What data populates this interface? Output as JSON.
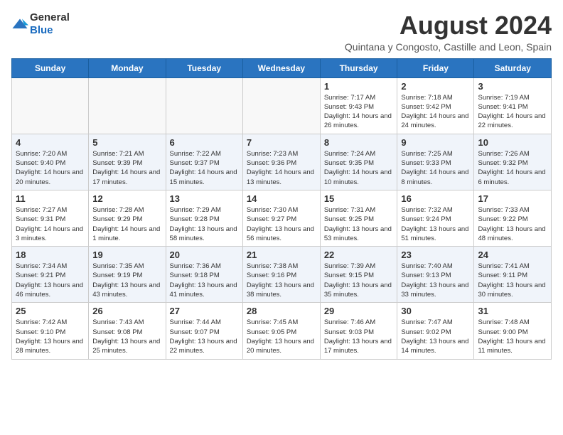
{
  "header": {
    "logo_general": "General",
    "logo_blue": "Blue",
    "month_year": "August 2024",
    "location": "Quintana y Congosto, Castille and Leon, Spain"
  },
  "days_of_week": [
    "Sunday",
    "Monday",
    "Tuesday",
    "Wednesday",
    "Thursday",
    "Friday",
    "Saturday"
  ],
  "weeks": [
    {
      "alt": false,
      "days": [
        {
          "num": "",
          "info": ""
        },
        {
          "num": "",
          "info": ""
        },
        {
          "num": "",
          "info": ""
        },
        {
          "num": "",
          "info": ""
        },
        {
          "num": "1",
          "info": "Sunrise: 7:17 AM\nSunset: 9:43 PM\nDaylight: 14 hours and 26 minutes."
        },
        {
          "num": "2",
          "info": "Sunrise: 7:18 AM\nSunset: 9:42 PM\nDaylight: 14 hours and 24 minutes."
        },
        {
          "num": "3",
          "info": "Sunrise: 7:19 AM\nSunset: 9:41 PM\nDaylight: 14 hours and 22 minutes."
        }
      ]
    },
    {
      "alt": true,
      "days": [
        {
          "num": "4",
          "info": "Sunrise: 7:20 AM\nSunset: 9:40 PM\nDaylight: 14 hours and 20 minutes."
        },
        {
          "num": "5",
          "info": "Sunrise: 7:21 AM\nSunset: 9:39 PM\nDaylight: 14 hours and 17 minutes."
        },
        {
          "num": "6",
          "info": "Sunrise: 7:22 AM\nSunset: 9:37 PM\nDaylight: 14 hours and 15 minutes."
        },
        {
          "num": "7",
          "info": "Sunrise: 7:23 AM\nSunset: 9:36 PM\nDaylight: 14 hours and 13 minutes."
        },
        {
          "num": "8",
          "info": "Sunrise: 7:24 AM\nSunset: 9:35 PM\nDaylight: 14 hours and 10 minutes."
        },
        {
          "num": "9",
          "info": "Sunrise: 7:25 AM\nSunset: 9:33 PM\nDaylight: 14 hours and 8 minutes."
        },
        {
          "num": "10",
          "info": "Sunrise: 7:26 AM\nSunset: 9:32 PM\nDaylight: 14 hours and 6 minutes."
        }
      ]
    },
    {
      "alt": false,
      "days": [
        {
          "num": "11",
          "info": "Sunrise: 7:27 AM\nSunset: 9:31 PM\nDaylight: 14 hours and 3 minutes."
        },
        {
          "num": "12",
          "info": "Sunrise: 7:28 AM\nSunset: 9:29 PM\nDaylight: 14 hours and 1 minute."
        },
        {
          "num": "13",
          "info": "Sunrise: 7:29 AM\nSunset: 9:28 PM\nDaylight: 13 hours and 58 minutes."
        },
        {
          "num": "14",
          "info": "Sunrise: 7:30 AM\nSunset: 9:27 PM\nDaylight: 13 hours and 56 minutes."
        },
        {
          "num": "15",
          "info": "Sunrise: 7:31 AM\nSunset: 9:25 PM\nDaylight: 13 hours and 53 minutes."
        },
        {
          "num": "16",
          "info": "Sunrise: 7:32 AM\nSunset: 9:24 PM\nDaylight: 13 hours and 51 minutes."
        },
        {
          "num": "17",
          "info": "Sunrise: 7:33 AM\nSunset: 9:22 PM\nDaylight: 13 hours and 48 minutes."
        }
      ]
    },
    {
      "alt": true,
      "days": [
        {
          "num": "18",
          "info": "Sunrise: 7:34 AM\nSunset: 9:21 PM\nDaylight: 13 hours and 46 minutes."
        },
        {
          "num": "19",
          "info": "Sunrise: 7:35 AM\nSunset: 9:19 PM\nDaylight: 13 hours and 43 minutes."
        },
        {
          "num": "20",
          "info": "Sunrise: 7:36 AM\nSunset: 9:18 PM\nDaylight: 13 hours and 41 minutes."
        },
        {
          "num": "21",
          "info": "Sunrise: 7:38 AM\nSunset: 9:16 PM\nDaylight: 13 hours and 38 minutes."
        },
        {
          "num": "22",
          "info": "Sunrise: 7:39 AM\nSunset: 9:15 PM\nDaylight: 13 hours and 35 minutes."
        },
        {
          "num": "23",
          "info": "Sunrise: 7:40 AM\nSunset: 9:13 PM\nDaylight: 13 hours and 33 minutes."
        },
        {
          "num": "24",
          "info": "Sunrise: 7:41 AM\nSunset: 9:11 PM\nDaylight: 13 hours and 30 minutes."
        }
      ]
    },
    {
      "alt": false,
      "days": [
        {
          "num": "25",
          "info": "Sunrise: 7:42 AM\nSunset: 9:10 PM\nDaylight: 13 hours and 28 minutes."
        },
        {
          "num": "26",
          "info": "Sunrise: 7:43 AM\nSunset: 9:08 PM\nDaylight: 13 hours and 25 minutes."
        },
        {
          "num": "27",
          "info": "Sunrise: 7:44 AM\nSunset: 9:07 PM\nDaylight: 13 hours and 22 minutes."
        },
        {
          "num": "28",
          "info": "Sunrise: 7:45 AM\nSunset: 9:05 PM\nDaylight: 13 hours and 20 minutes."
        },
        {
          "num": "29",
          "info": "Sunrise: 7:46 AM\nSunset: 9:03 PM\nDaylight: 13 hours and 17 minutes."
        },
        {
          "num": "30",
          "info": "Sunrise: 7:47 AM\nSunset: 9:02 PM\nDaylight: 13 hours and 14 minutes."
        },
        {
          "num": "31",
          "info": "Sunrise: 7:48 AM\nSunset: 9:00 PM\nDaylight: 13 hours and 11 minutes."
        }
      ]
    }
  ]
}
